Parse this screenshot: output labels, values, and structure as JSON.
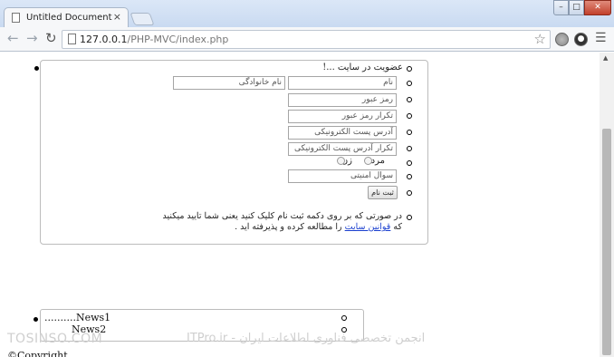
{
  "browser": {
    "tab_title": "Untitled Document",
    "tab_close": "×",
    "url_host": "127.0.0.1",
    "url_path": "/PHP-MVC/index.php",
    "window_controls": {
      "minimize": "–",
      "maximize": "□",
      "close": "✕"
    },
    "icons": [
      "page-icon",
      "back-icon",
      "forward-icon",
      "reload-icon",
      "star-icon",
      "globe-icon",
      "extension-icon",
      "menu-icon"
    ]
  },
  "form": {
    "heading": "عضویت در سایت ...!",
    "first_name_placeholder": "نام",
    "last_name_placeholder": "نام خانوادگی",
    "password_placeholder": "رمز عبور",
    "password_repeat_placeholder": "تکرار رمز عبور",
    "email_placeholder": "آدرس پست الکترونیکی",
    "email_repeat_placeholder": "تکرار آدرس پست الکترونیکی",
    "gender_male": "مرد",
    "gender_female": "زن",
    "security_question_placeholder": "سوال امنیتی",
    "submit_label": "ثبت نام",
    "terms_line1": "در صورتی که بر روی دکمه ثبت نام کلیک کنید یعنی شما تایید میکنید",
    "terms_prefix": "که",
    "terms_link": "قوانین سایت",
    "terms_suffix": "را مطالعه کرده و پذیرفته اید ."
  },
  "news": {
    "items": [
      "..........News1",
      "News2"
    ]
  },
  "watermark": {
    "left": "TOSINSO.COM",
    "right": "ITPro.ir - انجمن تخصصی فناوری اطلاعات ایران"
  },
  "footer": {
    "copyright": "©Copyright"
  }
}
